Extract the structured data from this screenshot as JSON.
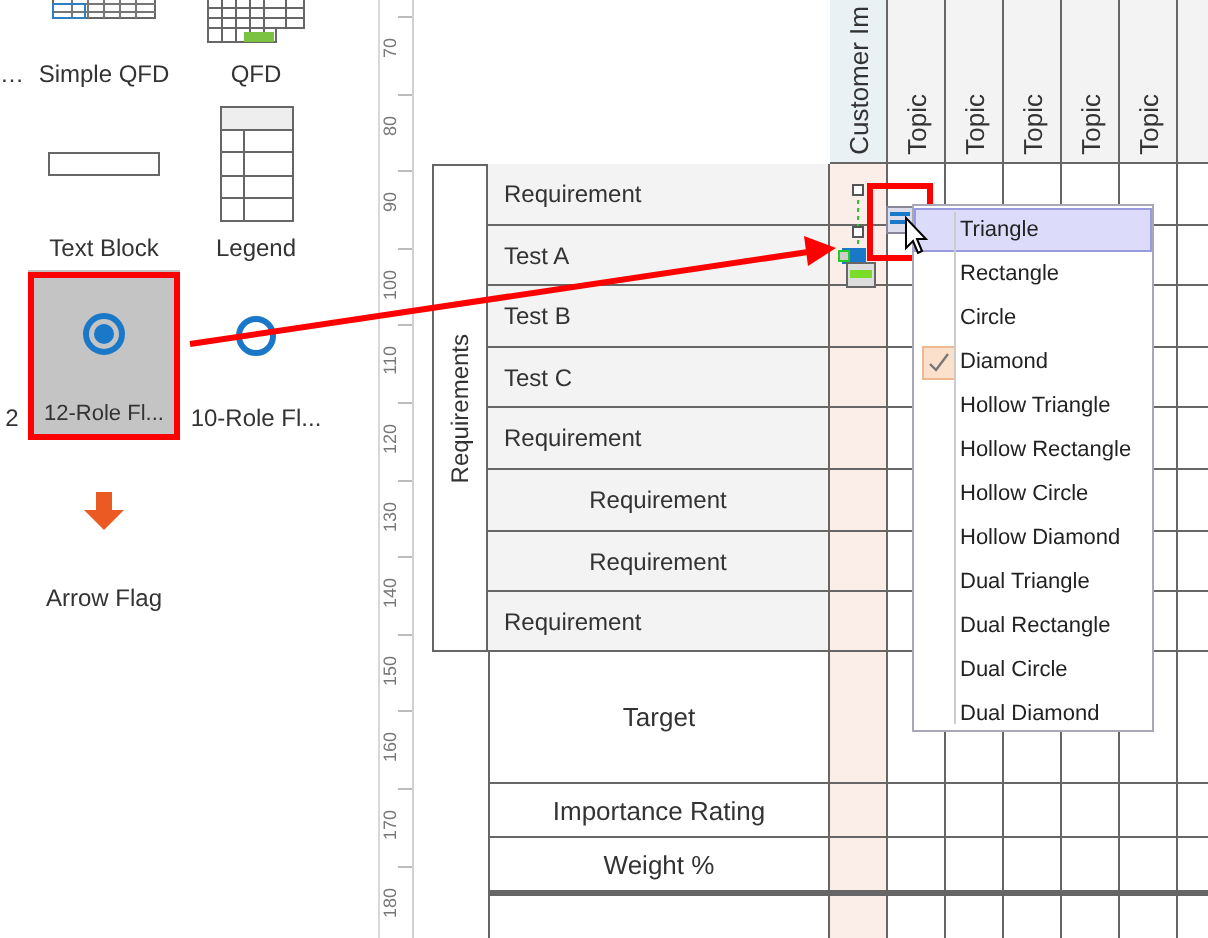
{
  "library": [
    {
      "label": "…",
      "kind": "cut",
      "selected": false
    },
    {
      "label": "Simple QFD",
      "kind": "simple-qfd",
      "selected": false
    },
    {
      "label": "QFD",
      "kind": "qfd",
      "selected": false
    },
    {
      "label": "Text Block",
      "kind": "text-block",
      "selected": false
    },
    {
      "label": "Legend",
      "kind": "legend",
      "selected": false
    },
    {
      "label": "2",
      "kind": "cut",
      "selected": false
    },
    {
      "label": "12-Role Fl...",
      "kind": "role-filled",
      "selected": true
    },
    {
      "label": "10-Role Fl...",
      "kind": "role-hollow",
      "selected": false
    },
    {
      "label": "Arrow Flag",
      "kind": "arrow-flag",
      "selected": false
    }
  ],
  "ruler": [
    "70",
    "80",
    "90",
    "100",
    "110",
    "120",
    "130",
    "140",
    "150",
    "160",
    "170",
    "180"
  ],
  "columns": [
    {
      "label": "Customer Im",
      "kind": "importance"
    },
    {
      "label": "Topic",
      "kind": "topic"
    },
    {
      "label": "Topic",
      "kind": "topic"
    },
    {
      "label": "Topic",
      "kind": "topic"
    },
    {
      "label": "Topic",
      "kind": "topic"
    },
    {
      "label": "Topic",
      "kind": "topic"
    },
    {
      "kind": "topic"
    }
  ],
  "requirements": {
    "label": "Requirements",
    "rows": [
      {
        "label": "Requirement",
        "centered": false
      },
      {
        "label": "Test A",
        "centered": false
      },
      {
        "label": "Test B",
        "centered": false
      },
      {
        "label": "Test C",
        "centered": false
      },
      {
        "label": "Requirement",
        "centered": false
      },
      {
        "label": "Requirement",
        "centered": true
      },
      {
        "label": "Requirement",
        "centered": true
      },
      {
        "label": "Requirement",
        "centered": false
      }
    ]
  },
  "summary_rows": [
    {
      "label": "Target",
      "kind": "tall"
    },
    {
      "label": "Importance Rating",
      "kind": "normal"
    },
    {
      "label": "Weight %",
      "kind": "normal"
    },
    {
      "kind": "footer"
    }
  ],
  "menu": [
    {
      "label": "Triangle",
      "selected": true,
      "checked": false
    },
    {
      "label": "Rectangle",
      "selected": false,
      "checked": false
    },
    {
      "label": "Circle",
      "selected": false,
      "checked": false
    },
    {
      "label": "Diamond",
      "selected": false,
      "checked": true
    },
    {
      "label": "Hollow Triangle",
      "selected": false,
      "checked": false
    },
    {
      "label": "Hollow Rectangle",
      "selected": false,
      "checked": false
    },
    {
      "label": "Hollow Circle",
      "selected": false,
      "checked": false
    },
    {
      "label": "Hollow Diamond",
      "selected": false,
      "checked": false
    },
    {
      "label": "Dual Triangle",
      "selected": false,
      "checked": false
    },
    {
      "label": "Dual Rectangle",
      "selected": false,
      "checked": false
    },
    {
      "label": "Dual Circle",
      "selected": false,
      "checked": false
    },
    {
      "label": "Dual Diamond",
      "selected": false,
      "checked": false
    }
  ]
}
